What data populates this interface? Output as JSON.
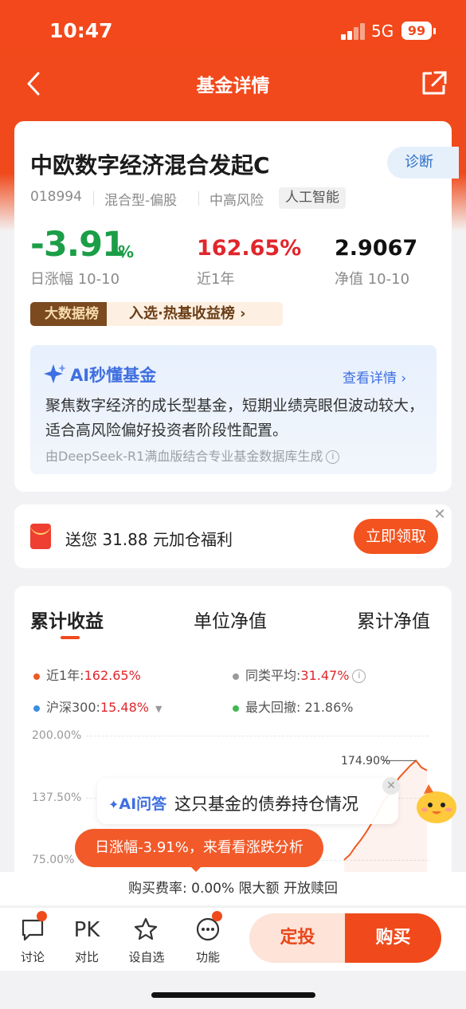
{
  "status": {
    "time": "10:47",
    "network": "5G",
    "battery": "99"
  },
  "nav": {
    "title": "基金详情"
  },
  "fund": {
    "name": "中欧数字经济混合发起C",
    "code": "018994",
    "type": "混合型-偏股",
    "risk": "中高风险",
    "tag": "人工智能",
    "diagnose": "诊断"
  },
  "stats": {
    "daily": "-3.91",
    "daily_unit": "%",
    "daily_label": "日涨幅 10-10",
    "year": "162.65%",
    "year_label": "近1年",
    "nav": "2.9067",
    "nav_label": "净值 10-10"
  },
  "bigdata": {
    "badge": "大数据榜",
    "text": "入选·热基收益榜 ›"
  },
  "ai": {
    "title": "AI秒懂基金",
    "detail": "查看详情 ›",
    "text": "聚焦数字经济的成长型基金，短期业绩亮眼但波动较大，适合高风险偏好投资者阶段性配置。",
    "source": "由DeepSeek-R1满血版结合专业基金数据库生成"
  },
  "promo": {
    "text": "送您 31.88 元加仓福利",
    "button": "立即领取"
  },
  "tabs": [
    "累计收益",
    "单位净值",
    "累计净值"
  ],
  "legend": {
    "year_label": "近1年:",
    "year_value": "162.65%",
    "peer_label": "同类平均:",
    "peer_value": "31.47%",
    "hs300_label": "沪深300:",
    "hs300_value": "15.48%",
    "drawdown": "最大回撤: 21.86%"
  },
  "colors": {
    "accent": "#f04a1c",
    "fund_line": "#ee5a24",
    "peer": "#9a9a9a",
    "hs300": "#3b8fe0",
    "drawdown": "#3fb950"
  },
  "chart_data": {
    "type": "line",
    "yticks": [
      "200.00%",
      "137.50%",
      "75.00%"
    ],
    "ylim": [
      75,
      200
    ],
    "series": [
      {
        "name": "近1年",
        "values": [
          75,
          80,
          88,
          95,
          103,
          112,
          122,
          133,
          140,
          150,
          158,
          164,
          170,
          174.9,
          168,
          165
        ]
      }
    ],
    "annotations": [
      "174.90%"
    ]
  },
  "qa": {
    "tag": "AI问答",
    "text": "这只基金的债券持仓情况"
  },
  "tip": "日涨幅-3.91%，来看看涨跌分析",
  "fee": "购买费率: 0.00% 限大额 开放赎回",
  "bottom": {
    "discuss": "讨论",
    "pk_icon": "PK",
    "pk": "对比",
    "fav": "设自选",
    "more": "功能",
    "sip": "定投",
    "buy": "购买"
  }
}
